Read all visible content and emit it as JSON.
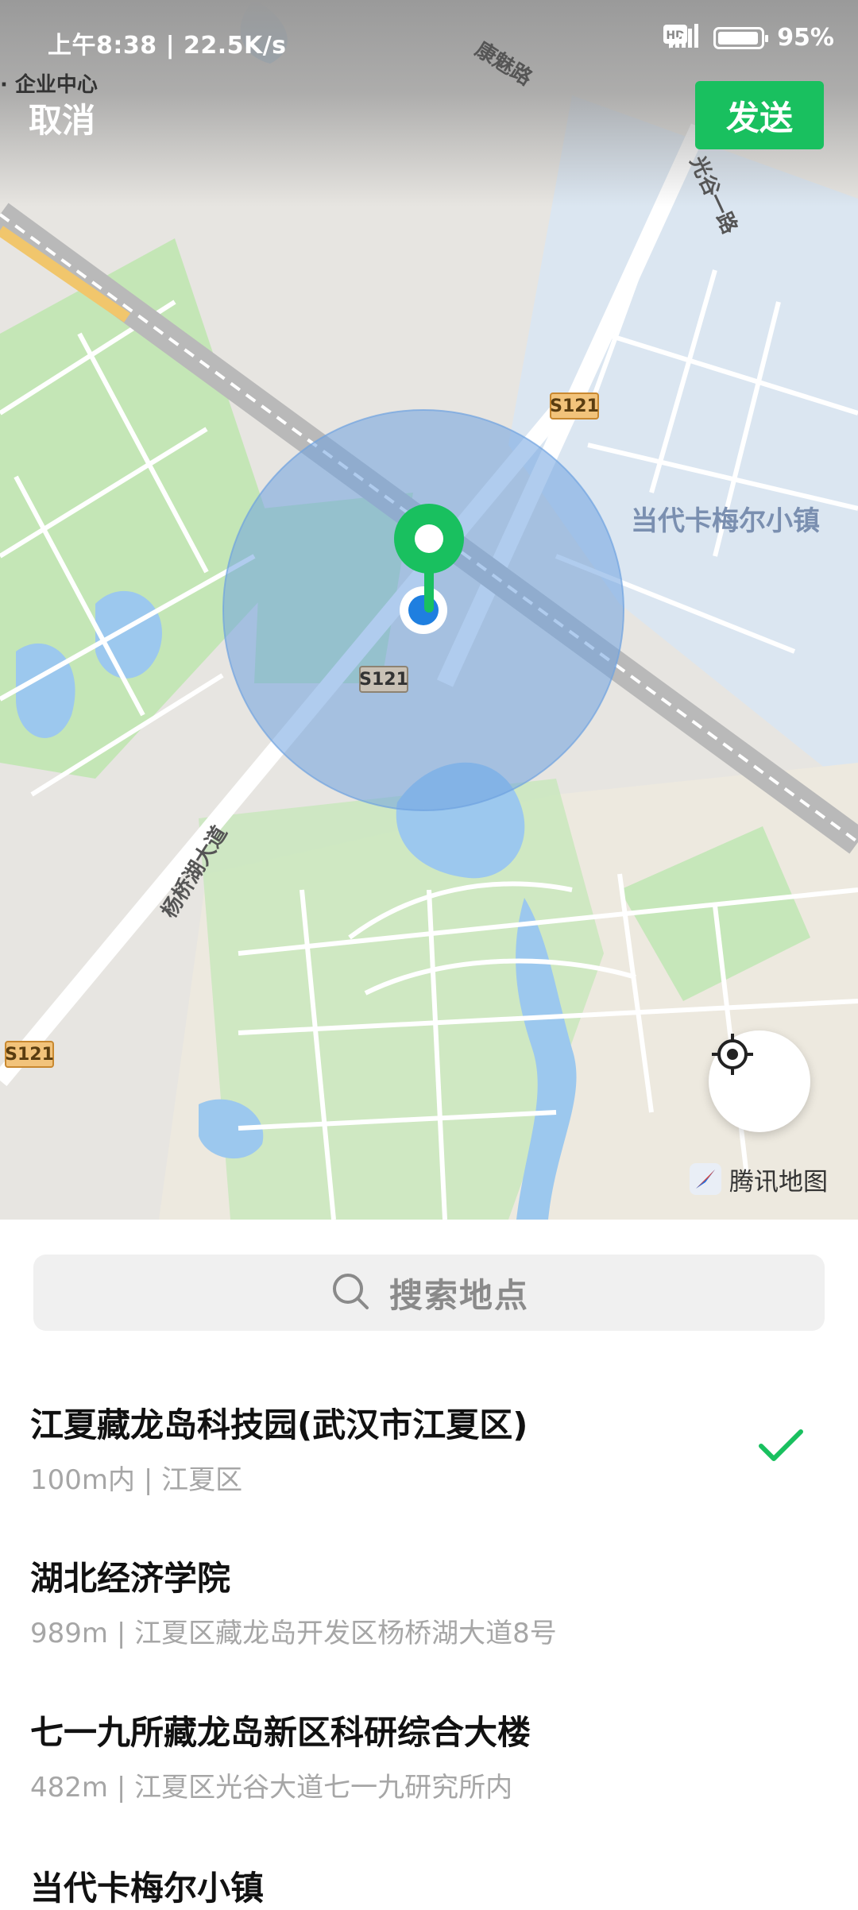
{
  "status_bar": {
    "time_speed": "上午8:38 | 22.5K/s",
    "battery": "95%",
    "network": "4G"
  },
  "header": {
    "cancel_label": "取消",
    "send_label": "发送",
    "map_top_label": "· 企业中心"
  },
  "map": {
    "place_labels": [
      "当代卡梅尔小镇"
    ],
    "road_labels": [
      "康魅路",
      "光谷一路",
      "杨桥湖大道"
    ],
    "road_shields": [
      "S121",
      "S121",
      "S121"
    ],
    "attribution": "腾讯地图",
    "locate_icon": "crosshair-icon",
    "colors": {
      "water": "#9cc8ee",
      "park": "#c4e6b6",
      "accent": "#19c05f",
      "location_dot": "#1f7fe0",
      "accuracy_circle": "#6fa3e0"
    }
  },
  "search": {
    "placeholder": "搜索地点",
    "icon": "search-icon"
  },
  "results": [
    {
      "name": "江夏藏龙岛科技园(武汉市江夏区)",
      "meta": "100m内 | 江夏区",
      "selected": true
    },
    {
      "name": "湖北经济学院",
      "meta": "989m | 江夏区藏龙岛开发区杨桥湖大道8号",
      "selected": false
    },
    {
      "name": "七一九所藏龙岛新区科研综合大楼",
      "meta": "482m | 江夏区光谷大道七一九研究所内",
      "selected": false
    },
    {
      "name": "当代卡梅尔小镇",
      "meta": "",
      "selected": false
    }
  ]
}
